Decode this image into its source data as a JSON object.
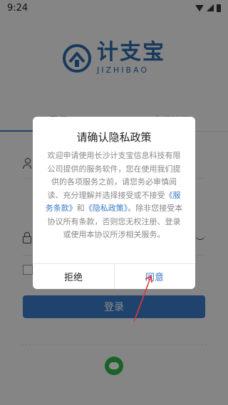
{
  "status_bar": {
    "time": "9:24"
  },
  "logo": {
    "chinese": "计支宝",
    "english": "JIZHIBAO"
  },
  "tabs": {
    "login": "登录",
    "register": "免费注册"
  },
  "login_button": "登录",
  "dialog": {
    "title": "请确认隐私政策",
    "body_part1": "欢迎申请使用长沙计支宝信息科技有限公司提供的服务软件，您在使用我们提供的各项服务之前，请您务必审慎阅读、充分理解并选择接受或不接受",
    "terms_link": "《服务条款》",
    "and": "和",
    "privacy_link": "《隐私政策》",
    "body_part2": "。除非您接受本协议所有条款，否则您无权注册、登录或使用本协议所涉相关服务。",
    "reject_label": "拒绝",
    "agree_label": "同意"
  },
  "colors": {
    "accent": "#3b7ac8",
    "brand": "#2d66a8",
    "annotation": "#d93a3a"
  }
}
